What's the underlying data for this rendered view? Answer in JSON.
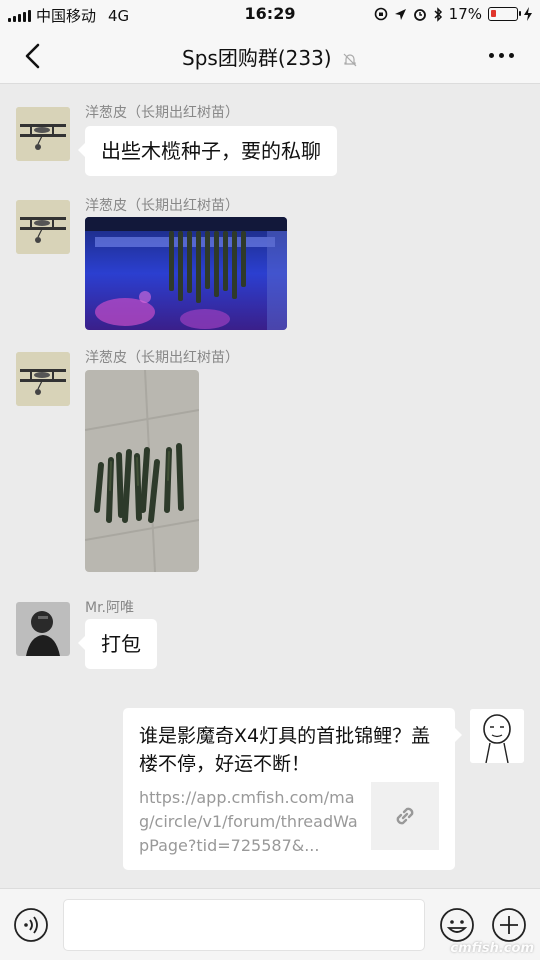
{
  "status_bar": {
    "carrier": "中国移动",
    "network": "4G",
    "time": "16:29",
    "battery_percent": "17%",
    "battery_level": 0.17
  },
  "nav": {
    "title": "Sps团购群(233)"
  },
  "messages": [
    {
      "sender": "洋葱皮（长期出红树苗）",
      "text": "出些木榄种子，要的私聊"
    },
    {
      "sender": "洋葱皮（长期出红树苗）"
    },
    {
      "sender": "洋葱皮（长期出红树苗）"
    },
    {
      "sender": "Mr.阿唯",
      "text": "打包"
    }
  ],
  "link_card": {
    "title": "谁是影魔奇X4灯具的首批锦鲤？盖楼不停，好运不断！",
    "url": "https://app.cmfish.com/mag/circle/v1/forum/threadWapPage?tid=725587&..."
  },
  "input_bar": {
    "voice_icon": "voice-icon",
    "emoji_icon": "emoji-icon",
    "plus_icon": "plus-icon"
  },
  "watermark": "cmfish.com",
  "colors": {
    "background": "#ebebeb",
    "bubble": "#ffffff",
    "battery_low": "#e0352b"
  }
}
